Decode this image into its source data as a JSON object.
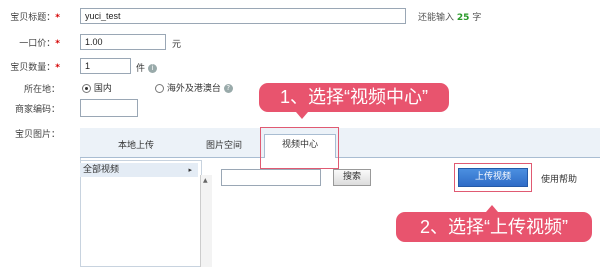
{
  "form": {
    "title_label": "宝贝标题：",
    "title_value": "yuci_test",
    "title_hint_prefix": "还能输入",
    "title_hint_count": "25",
    "title_hint_suffix": "字",
    "price_label": "一口价：",
    "price_value": "1.00",
    "price_unit": "元",
    "quantity_label": "宝贝数量：",
    "quantity_value": "1",
    "quantity_unit": "件",
    "location_label": "所在地：",
    "location_option_domestic": "国内",
    "location_option_overseas": "海外及港澳台",
    "merchant_code_label": "商家编码：",
    "merchant_code_value": "",
    "images_label": "宝贝图片："
  },
  "tabs": [
    {
      "label": "本地上传"
    },
    {
      "label": "图片空间"
    },
    {
      "label": "视频中心"
    }
  ],
  "video_center": {
    "folder_all": "全部视频",
    "search_value": "",
    "search_button": "搜索",
    "upload_button": "上传视频",
    "help_link": "使用帮助"
  },
  "annotations": {
    "step1": "1、选择“视频中心”",
    "step2": "2、选择“上传视频”"
  },
  "colors": {
    "callout": "#e8546e",
    "upload_button": "#3a7bd5",
    "required_star": "#d40000",
    "hint_count": "#2a9a2a"
  }
}
